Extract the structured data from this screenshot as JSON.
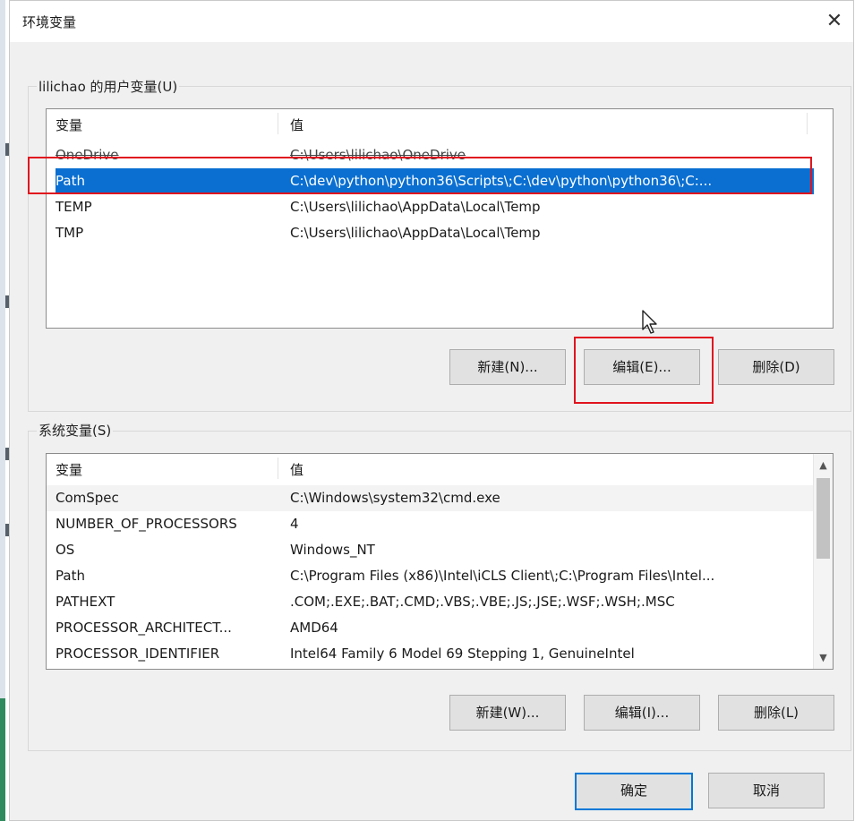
{
  "window": {
    "title": "环境变量",
    "close_glyph": "✕"
  },
  "user_vars": {
    "group_label": "lilichao 的用户变量(U)",
    "col_variable": "变量",
    "col_value": "值",
    "rows": [
      {
        "name": "OneDrive",
        "value": "C:\\Users\\lilichao\\OneDrive"
      },
      {
        "name": "Path",
        "value": "C:\\dev\\python\\python36\\Scripts\\;C:\\dev\\python\\python36\\;C:..."
      },
      {
        "name": "TEMP",
        "value": "C:\\Users\\lilichao\\AppData\\Local\\Temp"
      },
      {
        "name": "TMP",
        "value": "C:\\Users\\lilichao\\AppData\\Local\\Temp"
      }
    ],
    "selected_index": 1,
    "buttons": {
      "new": "新建(N)...",
      "edit": "编辑(E)...",
      "delete": "删除(D)"
    }
  },
  "system_vars": {
    "group_label": "系统变量(S)",
    "col_variable": "变量",
    "col_value": "值",
    "rows": [
      {
        "name": "ComSpec",
        "value": "C:\\Windows\\system32\\cmd.exe"
      },
      {
        "name": "NUMBER_OF_PROCESSORS",
        "value": "4"
      },
      {
        "name": "OS",
        "value": "Windows_NT"
      },
      {
        "name": "Path",
        "value": "C:\\Program Files (x86)\\Intel\\iCLS Client\\;C:\\Program Files\\Intel..."
      },
      {
        "name": "PATHEXT",
        "value": ".COM;.EXE;.BAT;.CMD;.VBS;.VBE;.JS;.JSE;.WSF;.WSH;.MSC"
      },
      {
        "name": "PROCESSOR_ARCHITECT...",
        "value": "AMD64"
      },
      {
        "name": "PROCESSOR_IDENTIFIER",
        "value": "Intel64 Family 6 Model 69 Stepping 1, GenuineIntel"
      }
    ],
    "buttons": {
      "new": "新建(W)...",
      "edit": "编辑(I)...",
      "delete": "删除(L)"
    }
  },
  "footer": {
    "ok": "确定",
    "cancel": "取消"
  },
  "colors": {
    "selection": "#0a6fd1",
    "annotation": "#e0141e",
    "default_button_border": "#0078d7"
  }
}
